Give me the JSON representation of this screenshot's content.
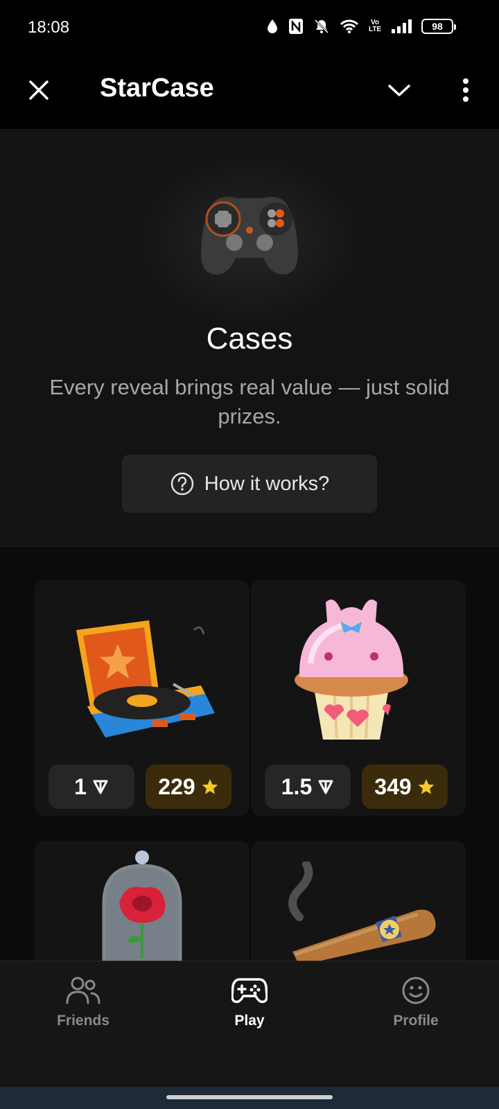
{
  "status_bar": {
    "time": "18:08",
    "battery": "98",
    "network_label": "Vo LTE"
  },
  "app_bar": {
    "title": "StarCase"
  },
  "hero": {
    "title": "Cases",
    "subtitle": "Every reveal brings real value — just solid prizes.",
    "how_button_label": "How it works?"
  },
  "cases": [
    {
      "name": "record-player-case",
      "icon": "record-player-icon",
      "ton_price": "1",
      "star_price": "229"
    },
    {
      "name": "cupcake-case",
      "icon": "cupcake-icon",
      "ton_price": "1.5",
      "star_price": "349"
    },
    {
      "name": "rose-case",
      "icon": "rose-dome-icon"
    },
    {
      "name": "cigar-case",
      "icon": "cigar-icon"
    }
  ],
  "bottom_nav": {
    "items": [
      {
        "label": "Friends",
        "icon": "friends-icon",
        "active": false
      },
      {
        "label": "Play",
        "icon": "gamepad-icon",
        "active": true
      },
      {
        "label": "Profile",
        "icon": "smiley-icon",
        "active": false
      }
    ]
  },
  "colors": {
    "background": "#000000",
    "hero_bg": "#131313",
    "card_bg": "#141414",
    "star_pill_bg": "#3a2c0b",
    "star_color": "#f7c928",
    "nav_bg": "#161616"
  }
}
